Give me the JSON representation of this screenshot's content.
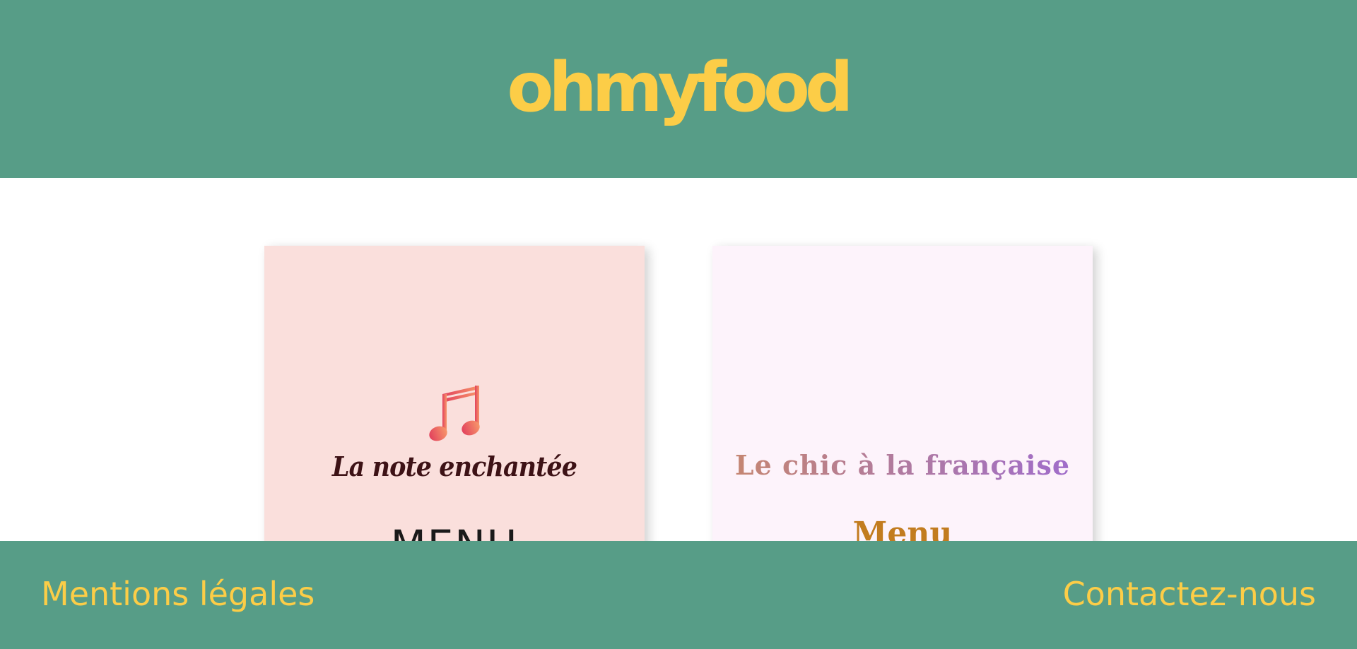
{
  "header": {
    "logo": "ohmyfood"
  },
  "restaurants": [
    {
      "icon": "music-note-icon",
      "name": "La note enchantée",
      "menu_label": "MENU"
    },
    {
      "name": "Le chic à la française",
      "menu_label": "Menu"
    }
  ],
  "footer": {
    "legal_label": "Mentions légales",
    "contact_label": "Contactez-nous"
  },
  "colors": {
    "primary_green": "#579d87",
    "accent_yellow": "#fccd47",
    "card_pink": "#fadfdc",
    "card_lavender": "#fdf3fb"
  }
}
